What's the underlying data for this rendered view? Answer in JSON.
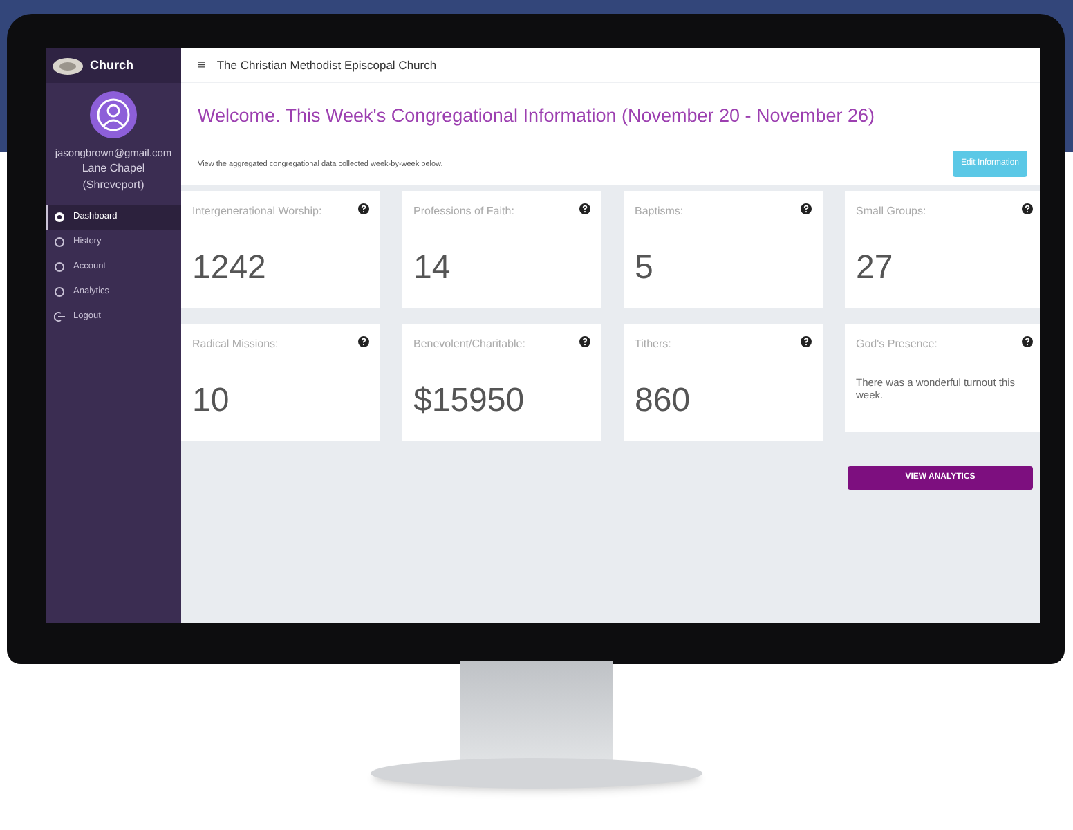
{
  "sidebar": {
    "brand": "Church",
    "user": {
      "email": "jasongbrown@gmail.com",
      "congregation": "Lane Chapel",
      "location": "(Shreveport)"
    },
    "items": [
      {
        "label": "Dashboard",
        "selected": true
      },
      {
        "label": "History",
        "selected": false
      },
      {
        "label": "Account",
        "selected": false
      },
      {
        "label": "Analytics",
        "selected": false
      },
      {
        "label": "Logout",
        "selected": false
      }
    ]
  },
  "header": {
    "menu_icon": "≡",
    "title": "The Christian Methodist Episcopal Church"
  },
  "welcome": {
    "heading": "Welcome. This Week's Congregational Information (November 20 - November 26)",
    "subtitle": "View the aggregated congregational data collected week-by-week below.",
    "edit_button": "Edit Information"
  },
  "cards": [
    {
      "kind": "number",
      "label": "Intergenerational Worship:",
      "value": "1242"
    },
    {
      "kind": "number",
      "label": "Professions of Faith:",
      "value": "14"
    },
    {
      "kind": "number",
      "label": "Baptisms:",
      "value": "5"
    },
    {
      "kind": "number",
      "label": "Small Groups:",
      "value": "27"
    },
    {
      "kind": "number",
      "label": "Radical Missions:",
      "value": "10"
    },
    {
      "kind": "number",
      "label": "Benevolent/Charitable:",
      "value": "$15950"
    },
    {
      "kind": "number",
      "label": "Tithers:",
      "value": "860"
    },
    {
      "kind": "text",
      "label": "God's Presence:",
      "value": "There was a wonderful turnout this week."
    }
  ],
  "analytics_button": "VIEW ANALYTICS"
}
